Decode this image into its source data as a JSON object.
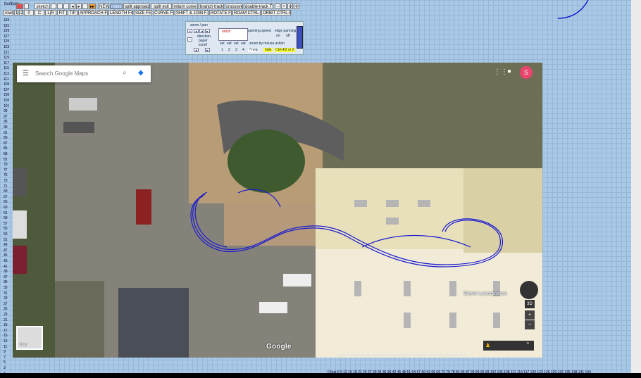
{
  "toolbar": {
    "label": "toolbars",
    "row1": [
      "sketch",
      "NEW",
      "notes",
      "split approach",
      "split exit",
      "return curve",
      "branch track",
      "crossover",
      "double-track TS"
    ],
    "row2": [
      "L|R",
      "FIT",
      "TIP",
      "APPROACH F3",
      "LENGTH F4",
      "SIZE F5",
      "CURVE F6",
      "SHIFT & JOIN F7",
      "ROTATE F8",
      "ROAM CTRL-F9",
      "ORBIT CTRL-F5"
    ],
    "small": [
      "rows",
      "1",
      "2",
      "0",
      "C"
    ]
  },
  "ruler_left": [
    "133",
    "131",
    "129",
    "127",
    "125",
    "123",
    "121",
    "119",
    "117",
    "115",
    "113",
    "111",
    "109",
    "107",
    "105",
    "103",
    "101",
    "99",
    "97",
    "95",
    "93",
    "91",
    "89",
    "87",
    "85",
    "83",
    "81",
    "79",
    "77",
    "75",
    "73",
    "71",
    "69",
    "67",
    "65",
    "63",
    "61",
    "59",
    "57",
    "55",
    "53",
    "51",
    "49",
    "47",
    "45",
    "43",
    "41",
    "39",
    "37",
    "35",
    "33",
    "31",
    "29",
    "27",
    "25",
    "23",
    "21",
    "19",
    "17",
    "15",
    "13",
    "11",
    "9",
    "7",
    "5",
    "3",
    "1"
  ],
  "ruler_bottom": "0 feet 6 9 12 15 18 21 24 27 30 33 36 39 42 45 48 51 54 57 60 63 66 69 72 75 78 81 84 87 90 93 96 99 102 105 108 111 114 117 120 123 126 129 132 135 138 141 144",
  "zoom_panel": {
    "title": "zoom / pan",
    "direction": "direction",
    "paper": "paper",
    "scroll": "scroll",
    "notch": "notch",
    "panning_speed": "panning speed",
    "edge_panning": "edge panning",
    "on": "on",
    "off": "off",
    "zoom_by": "zoom by mouse action",
    "help": "? help",
    "hide": "hide",
    "shortcut": "Ctrl+F2 or 2",
    "set_labels": [
      "set",
      "set",
      "set",
      "set"
    ],
    "digits": [
      "1",
      "2",
      "3",
      "4"
    ]
  },
  "map": {
    "search_placeholder": "Search Google Maps",
    "logo": "Google",
    "attribution": "Imagery ©2018 Google, Map data ©2018 Google   United States   Terms   Send feedback   20 ft",
    "place_label": "Stover Locomotives",
    "avatar_letter": "S",
    "map_button": "Map",
    "three_d": "3D"
  },
  "colors": {
    "canvas": "#a9c8e6",
    "track": "#1a1ad0",
    "avatar": "#e9456d"
  }
}
